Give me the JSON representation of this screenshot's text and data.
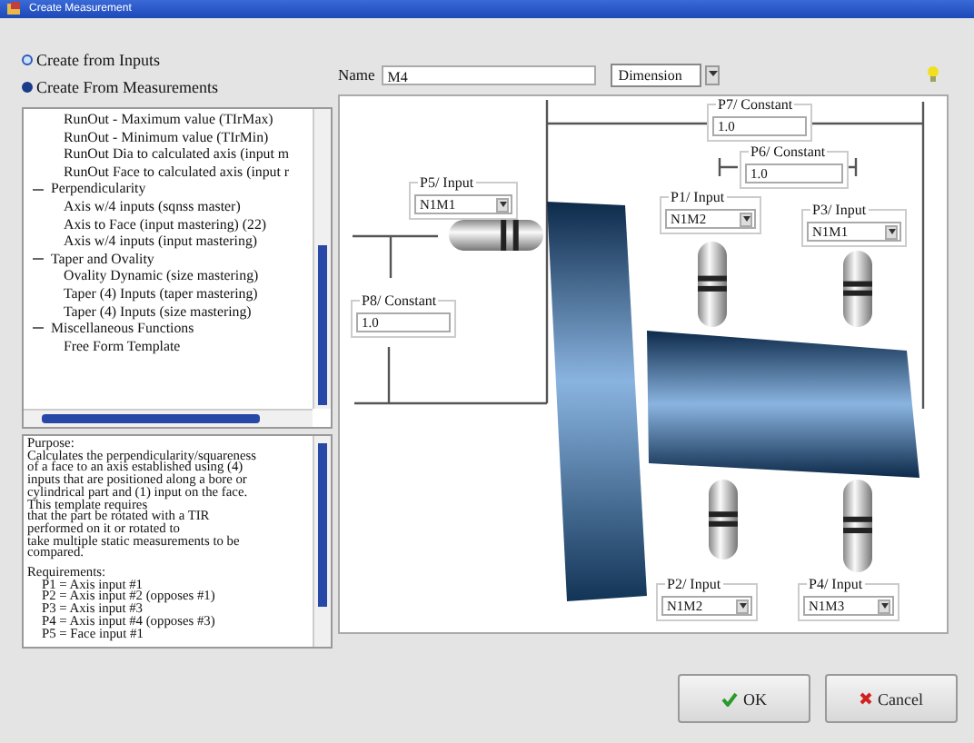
{
  "window": {
    "title": "Create Measurement"
  },
  "modes": [
    {
      "label": "Create from Inputs",
      "selected": false
    },
    {
      "label": "Create From Measurements",
      "selected": true
    }
  ],
  "template_tree": [
    {
      "children": [
        {
          "label": "RunOut - Maximum value (TIrMax)"
        },
        {
          "label": "RunOut - Minimum value (TIrMin)"
        },
        {
          "label": "RunOut Dia to calculated axis  (input m"
        },
        {
          "label": "RunOut Face to calculated axis  (input r"
        }
      ]
    },
    {
      "label": "Perpendicularity",
      "expanded": true,
      "children": [
        {
          "label": "Axis w/4 inputs (sqnss master)"
        },
        {
          "label": "Axis to Face (input mastering) (22)"
        },
        {
          "label": "Axis w/4 inputs  (input mastering)"
        }
      ]
    },
    {
      "label": "Taper and Ovality",
      "expanded": true,
      "children": [
        {
          "label": "Ovality Dynamic (size mastering)"
        },
        {
          "label": "Taper (4) Inputs (taper mastering)"
        },
        {
          "label": "Taper (4) Inputs (size mastering)"
        }
      ]
    },
    {
      "label": "Miscellaneous Functions",
      "expanded": true,
      "children": [
        {
          "label": "Free Form Template"
        }
      ]
    }
  ],
  "description": {
    "paragraphs": [
      [
        "Purpose:",
        "Calculates the perpendicularity/squareness",
        "of a face to an axis established using (4)",
        "inputs that are positioned along a bore or",
        "cylindrical part and (1) input on the face.",
        "This template requires",
        "that the part be rotated with a TIR",
        "performed on it or rotated to",
        "take multiple static measurements to be",
        "compared."
      ],
      [
        "Requirements:",
        "P1 = Axis input #1",
        "P2 = Axis input #2 (opposes #1)",
        "P3 = Axis input #3",
        "P4 = Axis input #4 (opposes #3)",
        "P5 = Face input #1"
      ]
    ]
  },
  "name_field": {
    "label": "Name",
    "value": "M4"
  },
  "type_dropdown": {
    "value": "Dimension"
  },
  "diagram": {
    "parameters": [
      {
        "label": "P7/ Constant",
        "kind": "constant",
        "value": "1.0"
      },
      {
        "label": "P6/ Constant",
        "kind": "constant",
        "value": "1.0"
      },
      {
        "label": "P5/ Input",
        "kind": "input",
        "value": "N1M1"
      },
      {
        "label": "P1/ Input",
        "kind": "input",
        "value": "N1M2"
      },
      {
        "label": "P3/ Input",
        "kind": "input",
        "value": "N1M1"
      },
      {
        "label": "P8/ Constant",
        "kind": "constant",
        "value": "1.0"
      },
      {
        "label": "P2/ Input",
        "kind": "input",
        "value": "N1M2"
      },
      {
        "label": "P4/ Input",
        "kind": "input",
        "value": "N1M3"
      }
    ]
  },
  "buttons": [
    {
      "label": "OK",
      "kind": "ok"
    },
    {
      "label": "Cancel",
      "kind": "cancel"
    }
  ]
}
